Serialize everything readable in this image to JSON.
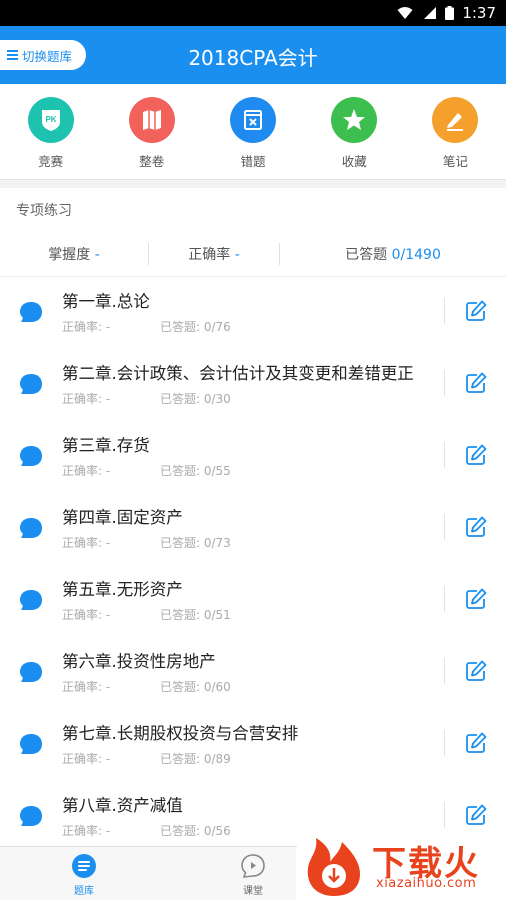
{
  "status_bar": {
    "time": "1:37"
  },
  "header": {
    "switch_label": "切换题库",
    "title": "2018CPA会计"
  },
  "quick_actions": [
    {
      "label": "竞赛",
      "icon": "pk-icon",
      "color": "#1ec3b0",
      "glyph": "PK"
    },
    {
      "label": "整卷",
      "icon": "map-icon",
      "color": "#f2625a"
    },
    {
      "label": "错题",
      "icon": "wrong-book-icon",
      "color": "#1f8bf0"
    },
    {
      "label": "收藏",
      "icon": "star-icon",
      "color": "#3cbf4f"
    },
    {
      "label": "笔记",
      "icon": "pencil-icon",
      "color": "#f5a02c"
    }
  ],
  "section_title": "专项练习",
  "stats": {
    "mastery_label": "掌握度",
    "mastery_value": "-",
    "accuracy_label": "正确率",
    "accuracy_value": "-",
    "answered_label": "已答题",
    "answered_value": "0/1490"
  },
  "chapters": [
    {
      "title": "第一章.总论",
      "accuracy_label": "正确率: -",
      "answered_label": "已答题: 0/76"
    },
    {
      "title": "第二章.会计政策、会计估计及其变更和差错更正",
      "accuracy_label": "正确率: -",
      "answered_label": "已答题: 0/30"
    },
    {
      "title": "第三章.存货",
      "accuracy_label": "正确率: -",
      "answered_label": "已答题: 0/55"
    },
    {
      "title": "第四章.固定资产",
      "accuracy_label": "正确率: -",
      "answered_label": "已答题: 0/73"
    },
    {
      "title": "第五章.无形资产",
      "accuracy_label": "正确率: -",
      "answered_label": "已答题: 0/51"
    },
    {
      "title": "第六章.投资性房地产",
      "accuracy_label": "正确率: -",
      "answered_label": "已答题: 0/60"
    },
    {
      "title": "第七章.长期股权投资与合营安排",
      "accuracy_label": "正确率: -",
      "answered_label": "已答题: 0/89"
    },
    {
      "title": "第八章.资产减值",
      "accuracy_label": "正确率: -",
      "answered_label": "已答题: 0/56"
    }
  ],
  "bottom_nav": [
    {
      "label": "题库",
      "icon": "question-bank-icon",
      "active": true
    },
    {
      "label": "课堂",
      "icon": "classroom-icon",
      "active": false
    }
  ],
  "watermark": {
    "brand": "下载火",
    "url": "xiazaihuo.com"
  },
  "colors": {
    "primary": "#1a8ff0",
    "watermark": "#e8431d"
  }
}
